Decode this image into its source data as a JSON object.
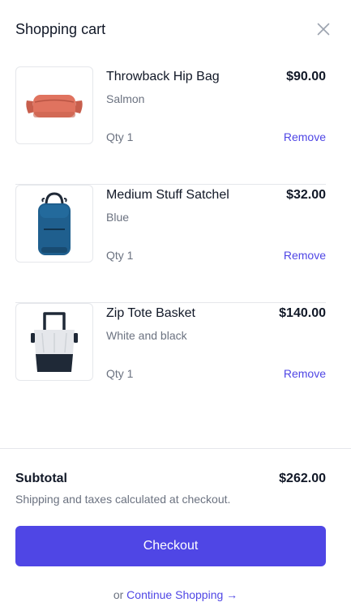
{
  "header": {
    "title": "Shopping cart",
    "close_icon": "close-icon"
  },
  "items": [
    {
      "name": "Throwback Hip Bag",
      "variant": "Salmon",
      "price": "$90.00",
      "qty": "Qty 1",
      "remove": "Remove",
      "image_icon": "hip-bag-image"
    },
    {
      "name": "Medium Stuff Satchel",
      "variant": "Blue",
      "price": "$32.00",
      "qty": "Qty 1",
      "remove": "Remove",
      "image_icon": "satchel-backpack-image"
    },
    {
      "name": "Zip Tote Basket",
      "variant": "White and black",
      "price": "$140.00",
      "qty": "Qty 1",
      "remove": "Remove",
      "image_icon": "tote-basket-image"
    }
  ],
  "footer": {
    "subtotal_label": "Subtotal",
    "subtotal_value": "$262.00",
    "shipping_note": "Shipping and taxes calculated at checkout.",
    "checkout_label": "Checkout",
    "continue_prefix": "or",
    "continue_label": "Continue Shopping",
    "continue_arrow": "→"
  },
  "colors": {
    "accent": "#4f46e5",
    "text": "#111827",
    "muted": "#6b7280",
    "divider": "#e5e7eb"
  }
}
